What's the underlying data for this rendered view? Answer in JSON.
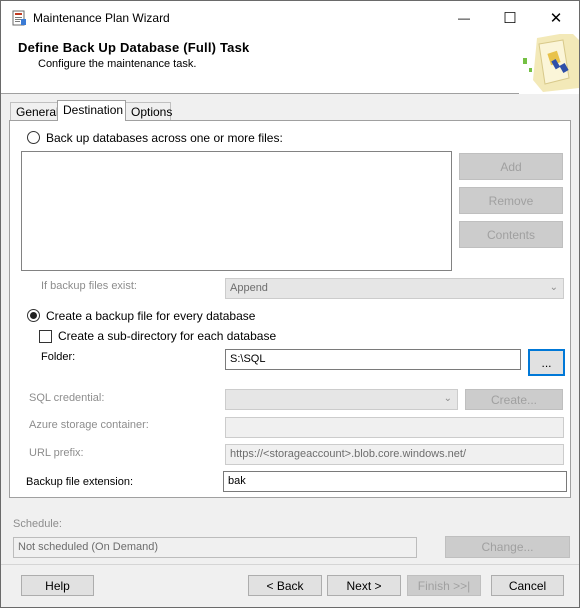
{
  "window": {
    "title": "Maintenance Plan Wizard",
    "minimize_glyph": "—",
    "maximize_glyph": "☐",
    "close_glyph": "✕"
  },
  "header": {
    "title": "Define Back Up Database (Full) Task",
    "subtitle": "Configure the maintenance task."
  },
  "tabs": [
    {
      "label": "General",
      "active": false
    },
    {
      "label": "Destination",
      "active": true
    },
    {
      "label": "Options",
      "active": false
    }
  ],
  "destination": {
    "backup_across_files_label": "Back up databases across one or more files:",
    "add_label": "Add",
    "remove_label": "Remove",
    "contents_label": "Contents",
    "if_exist_label": "If backup files exist:",
    "if_exist_value": "Append",
    "create_per_db_label": "Create a backup file for every database",
    "subdir_label": "Create a sub-directory for each database",
    "folder_label": "Folder:",
    "folder_value": "S:\\SQL",
    "browse_label": "...",
    "sql_credential_label": "SQL credential:",
    "sql_credential_value": "",
    "create_label": "Create...",
    "azure_container_label": "Azure storage container:",
    "azure_container_value": "",
    "url_prefix_label": "URL prefix:",
    "url_prefix_value": "https://<storageaccount>.blob.core.windows.net/",
    "extension_label": "Backup file extension:",
    "extension_value": "bak"
  },
  "schedule": {
    "label": "Schedule:",
    "value": "Not scheduled (On Demand)",
    "change_label": "Change..."
  },
  "footer": {
    "help_label": "Help",
    "back_label": "< Back",
    "next_label": "Next >",
    "finish_label": "Finish >>|",
    "cancel_label": "Cancel"
  },
  "colors": {
    "accent": "#0078d7",
    "disabled_text": "#8d8d8d"
  }
}
